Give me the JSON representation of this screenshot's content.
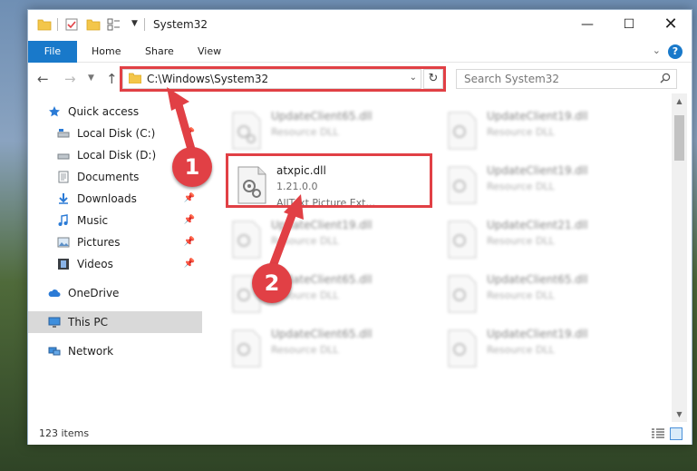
{
  "window": {
    "title": "System32",
    "controls": {
      "minimize": "—",
      "maximize": "☐",
      "close": "✕"
    }
  },
  "ribbon": {
    "tabs": [
      "File",
      "Home",
      "Share",
      "View"
    ],
    "help": "?"
  },
  "navigation": {
    "address": "C:\\Windows\\System32",
    "search_placeholder": "Search System32"
  },
  "sidebar": {
    "items": [
      {
        "label": "Quick access",
        "icon": "star-icon",
        "pinned": false
      },
      {
        "label": "Local Disk (C:)",
        "icon": "drive-icon",
        "pinned": true
      },
      {
        "label": "Local Disk (D:)",
        "icon": "drive-icon",
        "pinned": false
      },
      {
        "label": "Documents",
        "icon": "documents-icon",
        "pinned": true
      },
      {
        "label": "Downloads",
        "icon": "download-icon",
        "pinned": true
      },
      {
        "label": "Music",
        "icon": "music-icon",
        "pinned": true
      },
      {
        "label": "Pictures",
        "icon": "pictures-icon",
        "pinned": true
      },
      {
        "label": "Videos",
        "icon": "videos-icon",
        "pinned": true
      },
      {
        "label": "OneDrive",
        "icon": "cloud-icon",
        "pinned": false
      },
      {
        "label": "This PC",
        "icon": "computer-icon",
        "pinned": false,
        "selected": true
      },
      {
        "label": "Network",
        "icon": "network-icon",
        "pinned": false
      }
    ]
  },
  "files": {
    "col1": [
      {
        "name": "UpdateClient65.dll",
        "type": "Resource DLL"
      },
      {
        "name": "atxpic.dll",
        "version": "1.21.0.0",
        "description": "AllText Picture Ext..."
      },
      {
        "name": "UpdateClient19.dll",
        "type": "Resource DLL"
      },
      {
        "name": "UpdateClient65.dll",
        "type": "Resource DLL"
      },
      {
        "name": "UpdateClient65.dll",
        "type": "Resource DLL"
      }
    ],
    "col2": [
      {
        "name": "UpdateClient19.dll",
        "type": "Resource DLL"
      },
      {
        "name": "UpdateClient19.dll",
        "type": "Resource DLL"
      },
      {
        "name": "UpdateClient21.dll",
        "type": "Resource DLL"
      },
      {
        "name": "UpdateClient65.dll",
        "type": "Resource DLL"
      },
      {
        "name": "UpdateClient19.dll",
        "type": "Resource DLL"
      }
    ]
  },
  "status": {
    "item_count": "123 items"
  },
  "annotations": {
    "step1": "1",
    "step2": "2",
    "highlight_color": "#e14045"
  },
  "colors": {
    "accent": "#1979ca",
    "selection": "#d9d9d9"
  }
}
